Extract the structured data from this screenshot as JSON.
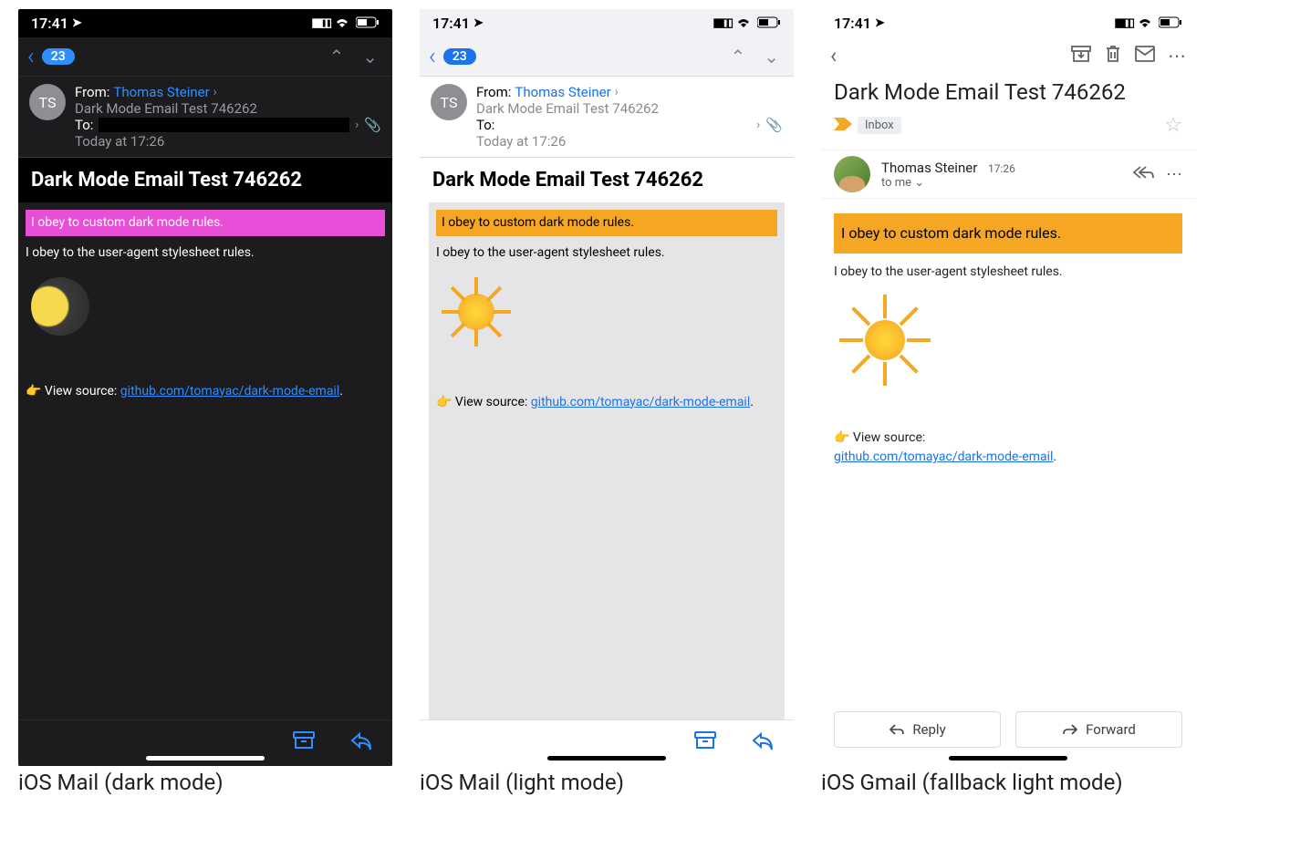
{
  "captions": {
    "dark": "iOS Mail (dark mode)",
    "light": "iOS Mail (light mode)",
    "gmail": "iOS Gmail (fallback light mode)"
  },
  "status": {
    "time": "17:41",
    "loc_glyph": "➤",
    "signal": "▪▪▫▫",
    "wifi": "📶",
    "battery": "🔲"
  },
  "mail": {
    "back_count": "23",
    "avatar_initials": "TS",
    "from_label": "From:",
    "from_name": "Thomas Steiner",
    "subject_muted": "Dark Mode Email Test 746262",
    "to_label": "To:",
    "date": "Today at 17:26",
    "subject": "Dark Mode Email Test 746262",
    "highlight_text": "I obey to custom dark mode rules.",
    "plain_text": "I obey to the user-agent stylesheet rules.",
    "source_prefix": "👉 View source: ",
    "source_link": "github.com/tomayac/dark-mode-email",
    "source_suffix": "."
  },
  "gmail": {
    "subject": "Dark Mode Email Test 746262",
    "label_name": "Inbox",
    "sender_name": "Thomas Steiner",
    "sender_time": "17:26",
    "to_text": "to me",
    "highlight_text": "I obey to custom dark mode rules.",
    "plain_text": "I obey to the user-agent stylesheet rules.",
    "source_prefix": "👉  View source:",
    "source_link": "github.com/tomayac/dark-mode-email",
    "source_suffix": ".",
    "reply_label": "Reply",
    "forward_label": "Forward"
  }
}
